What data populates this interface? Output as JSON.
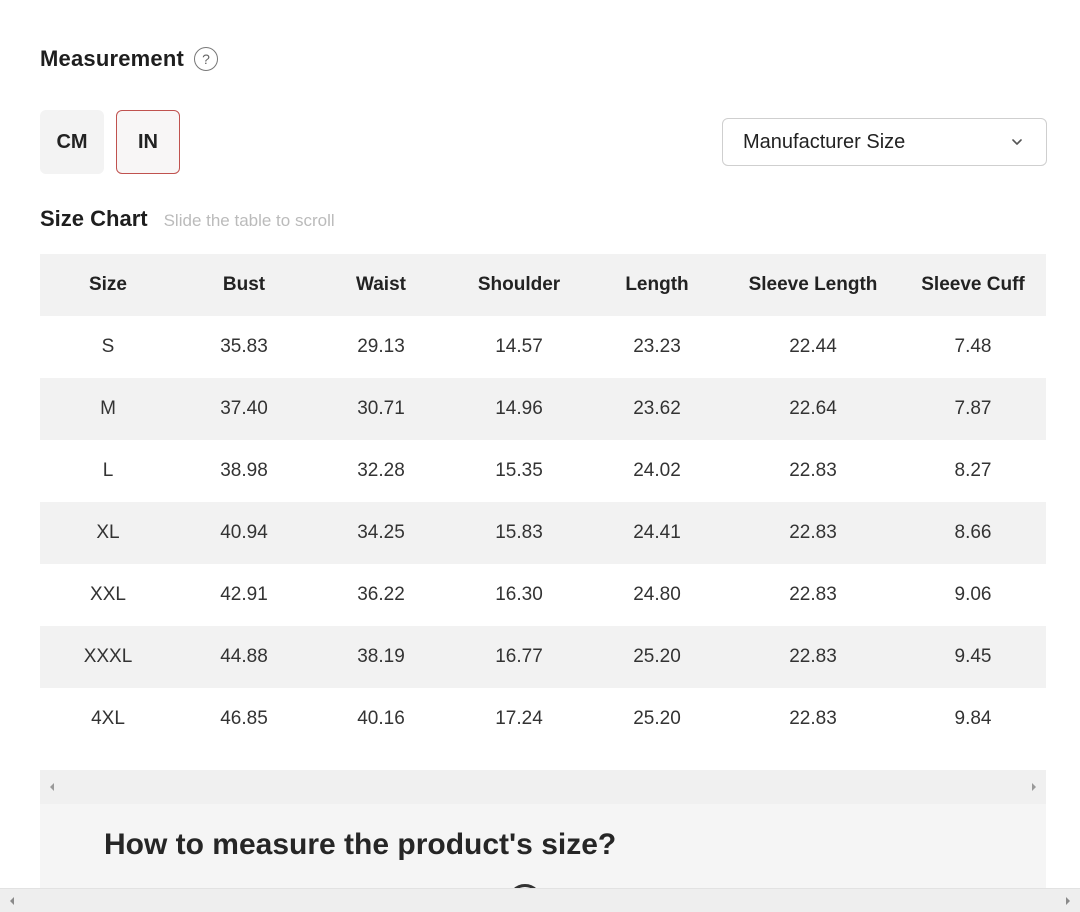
{
  "measurement": {
    "title": "Measurement",
    "help_icon": "?"
  },
  "units": {
    "cm": "CM",
    "in": "IN",
    "active": "IN"
  },
  "size_select": {
    "value": "Manufacturer Size"
  },
  "size_chart": {
    "title": "Size Chart",
    "hint": "Slide the table to scroll",
    "headers": [
      "Size",
      "Bust",
      "Waist",
      "Shoulder",
      "Length",
      "Sleeve Length",
      "Sleeve Cuff"
    ],
    "rows": [
      [
        "S",
        "35.83",
        "29.13",
        "14.57",
        "23.23",
        "22.44",
        "7.48"
      ],
      [
        "M",
        "37.40",
        "30.71",
        "14.96",
        "23.62",
        "22.64",
        "7.87"
      ],
      [
        "L",
        "38.98",
        "32.28",
        "15.35",
        "24.02",
        "22.83",
        "8.27"
      ],
      [
        "XL",
        "40.94",
        "34.25",
        "15.83",
        "24.41",
        "22.83",
        "8.66"
      ],
      [
        "XXL",
        "42.91",
        "36.22",
        "16.30",
        "24.80",
        "22.83",
        "9.06"
      ],
      [
        "XXXL",
        "44.88",
        "38.19",
        "16.77",
        "25.20",
        "22.83",
        "9.45"
      ],
      [
        "4XL",
        "46.85",
        "40.16",
        "17.24",
        "25.20",
        "22.83",
        "9.84"
      ]
    ]
  },
  "howto": {
    "title": "How to measure the product's size?"
  },
  "colors": {
    "active_border": "#c0524f",
    "stripe": "#f2f2f2"
  }
}
